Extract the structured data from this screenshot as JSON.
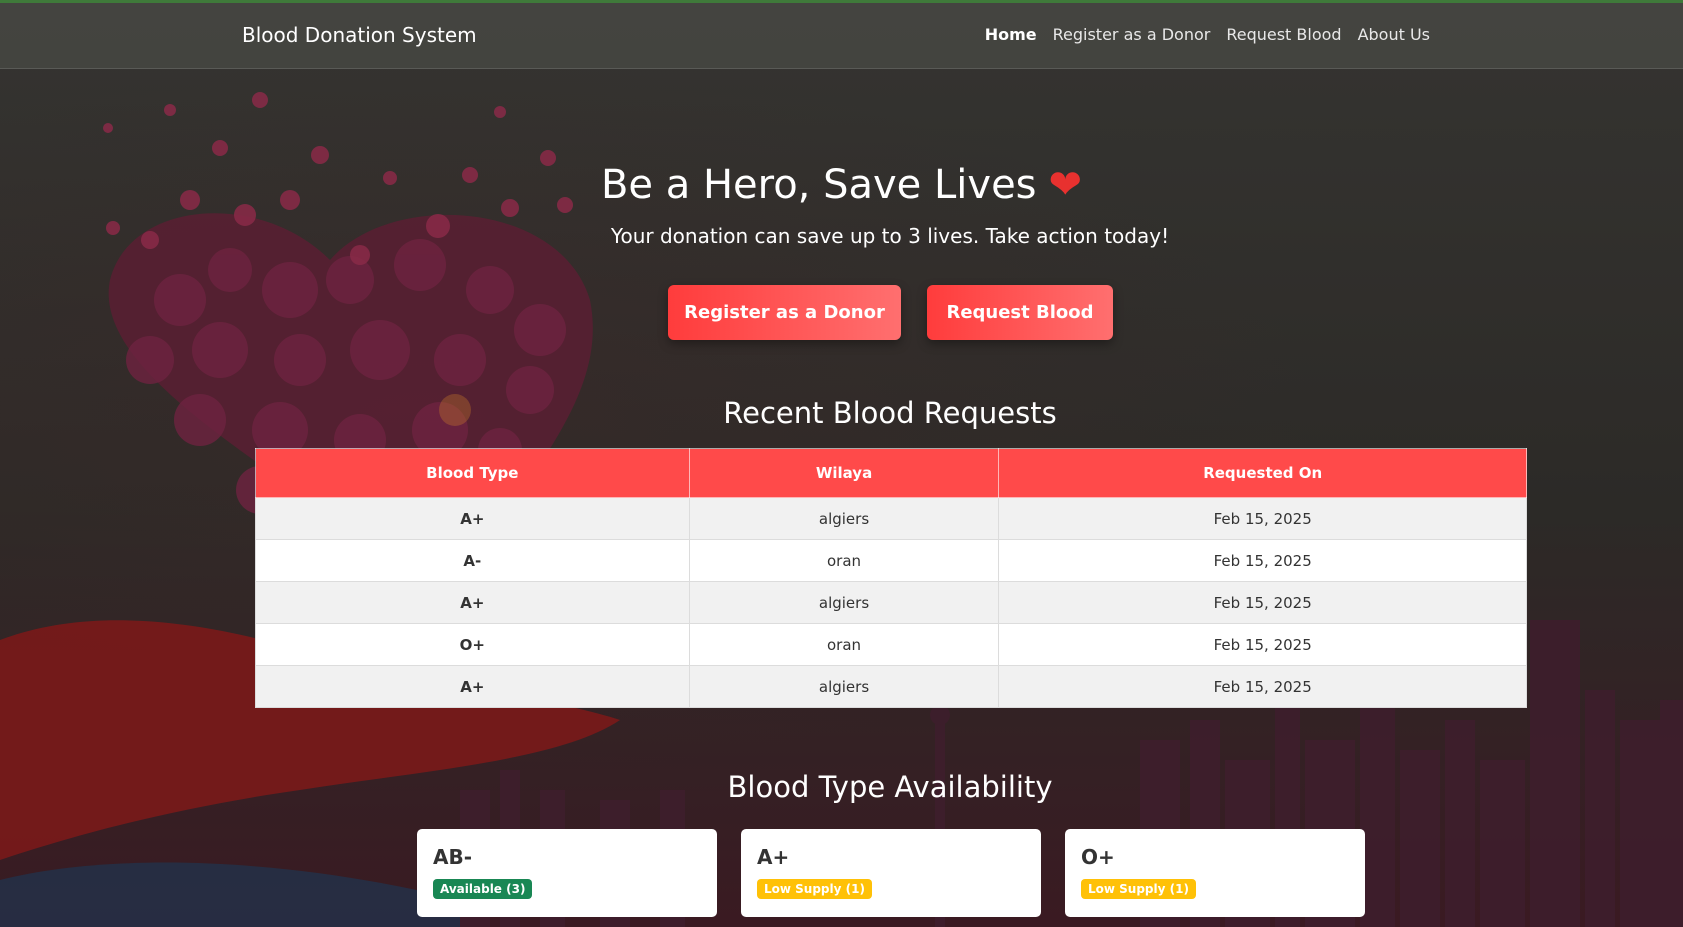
{
  "navbar": {
    "brand": "Blood Donation System",
    "links": [
      {
        "label": "Home",
        "active": true
      },
      {
        "label": "Register as a Donor",
        "active": false
      },
      {
        "label": "Request Blood",
        "active": false
      },
      {
        "label": "About Us",
        "active": false
      }
    ]
  },
  "hero": {
    "title": "Be a Hero, Save Lives",
    "heart_glyph": "❤",
    "subtitle": "Your donation can save up to 3 lives. Take action today!",
    "buttons": {
      "donor": "Register as a Donor",
      "request": "Request Blood"
    }
  },
  "requests": {
    "title": "Recent Blood Requests",
    "columns": [
      "Blood Type",
      "Wilaya",
      "Requested On"
    ],
    "rows": [
      [
        "A+",
        "algiers",
        "Feb 15, 2025"
      ],
      [
        "A-",
        "oran",
        "Feb 15, 2025"
      ],
      [
        "A+",
        "algiers",
        "Feb 15, 2025"
      ],
      [
        "O+",
        "oran",
        "Feb 15, 2025"
      ],
      [
        "A+",
        "algiers",
        "Feb 15, 2025"
      ]
    ]
  },
  "availability": {
    "title": "Blood Type Availability",
    "cards": [
      {
        "type": "AB-",
        "status": "Available (3)"
      },
      {
        "type": "A+",
        "status": "Low Supply (1)"
      },
      {
        "type": "O+",
        "status": "Low Supply (1)"
      }
    ]
  },
  "colors": {
    "accent": "#ff4a4a",
    "available": "#198754",
    "low_supply": "#ffc107"
  }
}
